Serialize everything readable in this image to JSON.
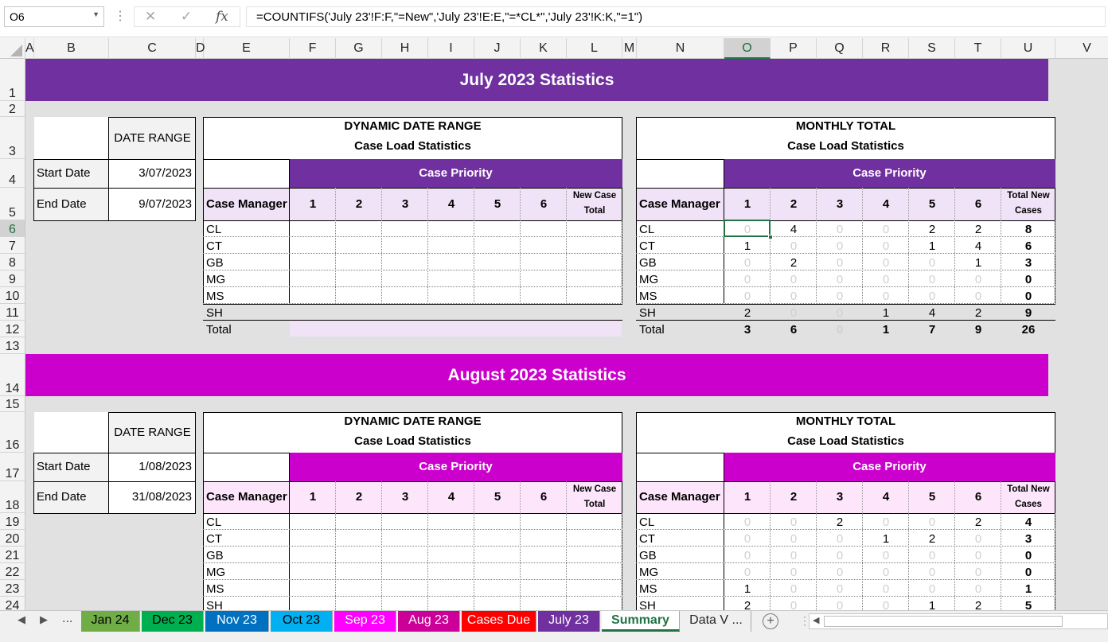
{
  "formula_bar": {
    "name_box": "O6",
    "formula": "=COUNTIFS('July 23'!F:F,\"=New\",'July 23'!E:E,\"=*CL*\",'July 23'!K:K,\"=1\")"
  },
  "columns": [
    "A",
    "B",
    "C",
    "D",
    "E",
    "F",
    "G",
    "H",
    "I",
    "J",
    "K",
    "L",
    "M",
    "N",
    "O",
    "P",
    "Q",
    "R",
    "S",
    "T",
    "U",
    "V"
  ],
  "rows": [
    "1",
    "2",
    "3",
    "4",
    "5",
    "6",
    "7",
    "8",
    "9",
    "10",
    "11",
    "12",
    "13",
    "14",
    "15",
    "16",
    "17",
    "18",
    "19",
    "20",
    "21",
    "22",
    "23",
    "24"
  ],
  "colors": {
    "july": "#7030a0",
    "july_light": "#f0e2f7",
    "august": "#cc00cc",
    "august_light": "#fde6fb"
  },
  "sections": [
    {
      "title": "July 2023 Statistics",
      "date_range_label": "DATE RANGE",
      "start_label": "Start Date",
      "start_value": "3/07/2023",
      "end_label": "End Date",
      "end_value": "9/07/2023",
      "dyn_title1": "DYNAMIC DATE RANGE",
      "dyn_title2": "Case Load Statistics",
      "mon_title1": "MONTHLY TOTAL",
      "mon_title2": "Case Load Statistics",
      "priority_label": "Case Priority",
      "manager_label": "Case Manager",
      "priorities": [
        "1",
        "2",
        "3",
        "4",
        "5",
        "6"
      ],
      "dyn_total_label_1": "New Case",
      "dyn_total_label_2": "Total",
      "mon_total_label_1": "Total New",
      "mon_total_label_2": "Cases",
      "managers": [
        "CL",
        "CT",
        "GB",
        "MG",
        "MS",
        "SH"
      ],
      "total_label": "Total",
      "monthly": [
        [
          "0",
          "4",
          "0",
          "0",
          "2",
          "2",
          "8"
        ],
        [
          "1",
          "0",
          "0",
          "0",
          "1",
          "4",
          "6"
        ],
        [
          "0",
          "2",
          "0",
          "0",
          "0",
          "1",
          "3"
        ],
        [
          "0",
          "0",
          "0",
          "0",
          "0",
          "0",
          "0"
        ],
        [
          "0",
          "0",
          "0",
          "0",
          "0",
          "0",
          "0"
        ],
        [
          "2",
          "0",
          "0",
          "1",
          "4",
          "2",
          "9"
        ]
      ],
      "monthly_total": [
        "3",
        "6",
        "0",
        "1",
        "7",
        "9",
        "26"
      ]
    },
    {
      "title": "August 2023 Statistics",
      "date_range_label": "DATE RANGE",
      "start_label": "Start Date",
      "start_value": "1/08/2023",
      "end_label": "End Date",
      "end_value": "31/08/2023",
      "dyn_title1": "DYNAMIC DATE RANGE",
      "dyn_title2": "Case Load Statistics",
      "mon_title1": "MONTHLY TOTAL",
      "mon_title2": "Case Load Statistics",
      "priority_label": "Case Priority",
      "manager_label": "Case Manager",
      "priorities": [
        "1",
        "2",
        "3",
        "4",
        "5",
        "6"
      ],
      "dyn_total_label_1": "New Case",
      "dyn_total_label_2": "Total",
      "mon_total_label_1": "Total New",
      "mon_total_label_2": "Cases",
      "managers": [
        "CL",
        "CT",
        "GB",
        "MG",
        "MS",
        "SH"
      ],
      "monthly": [
        [
          "0",
          "0",
          "2",
          "0",
          "0",
          "2",
          "4"
        ],
        [
          "0",
          "0",
          "0",
          "1",
          "2",
          "0",
          "3"
        ],
        [
          "0",
          "0",
          "0",
          "0",
          "0",
          "0",
          "0"
        ],
        [
          "0",
          "0",
          "0",
          "0",
          "0",
          "0",
          "0"
        ],
        [
          "1",
          "0",
          "0",
          "0",
          "0",
          "0",
          "1"
        ],
        [
          "2",
          "0",
          "0",
          "0",
          "1",
          "2",
          "5"
        ]
      ]
    }
  ],
  "tabs": [
    {
      "label": "Jan 24",
      "color": "#70ad47",
      "text": "#000"
    },
    {
      "label": "Dec 23",
      "color": "#00b050",
      "text": "#000"
    },
    {
      "label": "Nov 23",
      "color": "#0070c0",
      "text": "#fff"
    },
    {
      "label": "Oct 23",
      "color": "#00b0f0",
      "text": "#000"
    },
    {
      "label": "Sep 23",
      "color": "#ff00ff",
      "text": "#fff"
    },
    {
      "label": "Aug 23",
      "color": "#cc0099",
      "text": "#fff"
    },
    {
      "label": "Cases Due",
      "color": "#ff0000",
      "text": "#fff"
    },
    {
      "label": "July 23",
      "color": "#7030a0",
      "text": "#fff"
    },
    {
      "label": "Summary",
      "color": "#ffffff",
      "text": "#217346"
    },
    {
      "label": "Data V ...",
      "color": "#f0f0f0",
      "text": "#262626"
    }
  ],
  "tab_nav": {
    "ellipsis": "..."
  }
}
